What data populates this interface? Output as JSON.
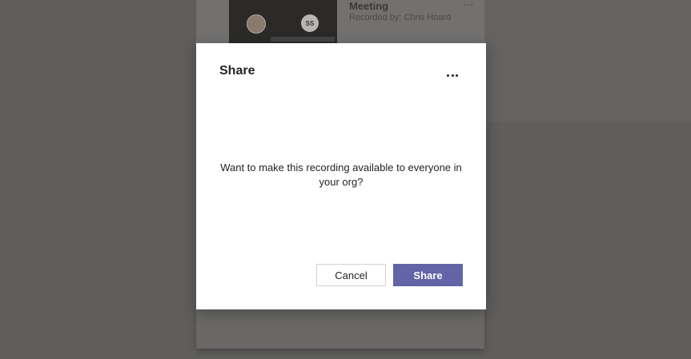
{
  "background": {
    "meeting_title": "Meeting",
    "recorded_by": "Recorded by: Chris Hoard",
    "avatar_initials": "SS",
    "more_glyph": "…"
  },
  "dialog": {
    "title": "Share",
    "message": "Want to make this recording available to everyone in your org?",
    "cancel_label": "Cancel",
    "share_label": "Share",
    "more_icon": "more-horizontal-icon",
    "accent_color": "#6264a7"
  }
}
